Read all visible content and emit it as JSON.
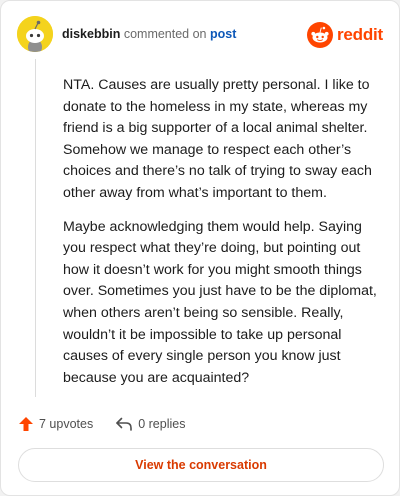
{
  "comment": {
    "username": "diskebbin",
    "action_text": "commented on",
    "post_link": "post",
    "paragraphs": [
      "NTA. Causes are usually pretty personal. I like to donate to the homeless in my state, whereas my friend is a big supporter of a local animal shelter. Somehow we manage to respect each other’s choices and there’s no talk of trying to sway each other away from what’s important to them.",
      "Maybe acknowledging them would help. Saying you respect what they’re doing, but pointing out how it doesn’t work for you might smooth things over. Sometimes you just have to be the diplomat, when others aren’t being so sensible. Really, wouldn’t it be impossible to take up personal causes of every single person you know just because you are acquainted?"
    ]
  },
  "brand": {
    "name": "reddit",
    "icon": "reddit-snoo-icon"
  },
  "footer": {
    "upvotes_label": "7 upvotes",
    "replies_label": "0 replies",
    "upvote_icon": "upvote-arrow-icon",
    "reply_icon": "reply-arrow-icon"
  },
  "cta": {
    "label": "View the conversation"
  },
  "colors": {
    "brand_orange": "#ff4500",
    "cta_text": "#d93a00",
    "link_blue": "#0d58b8",
    "avatar_bg": "#f4d31d"
  }
}
